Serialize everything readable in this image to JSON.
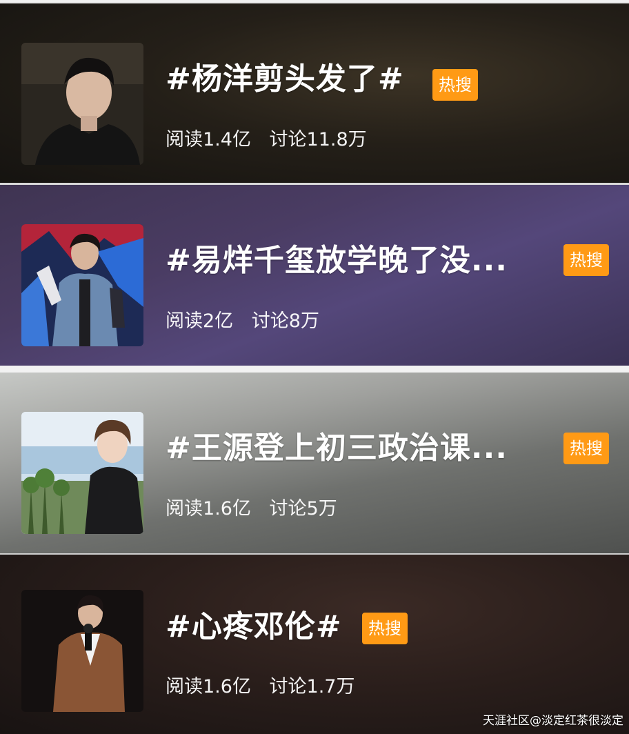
{
  "topics": [
    {
      "title": "#杨洋剪头发了#",
      "badge": "热搜",
      "read": "阅读1.4亿",
      "discuss": "讨论11.8万"
    },
    {
      "title": "#易烊千玺放学晚了没...",
      "badge": "热搜",
      "read": "阅读2亿",
      "discuss": "讨论8万"
    },
    {
      "title": "#王源登上初三政治课...",
      "badge": "热搜",
      "read": "阅读1.6亿",
      "discuss": "讨论5万"
    },
    {
      "title": "#心疼邓伦#",
      "badge": "热搜",
      "read": "阅读1.6亿",
      "discuss": "讨论1.7万"
    }
  ],
  "watermark": "天涯社区@淡定红茶很淡定",
  "colors": {
    "badge": "#ff9a15",
    "text": "#ffffff"
  }
}
